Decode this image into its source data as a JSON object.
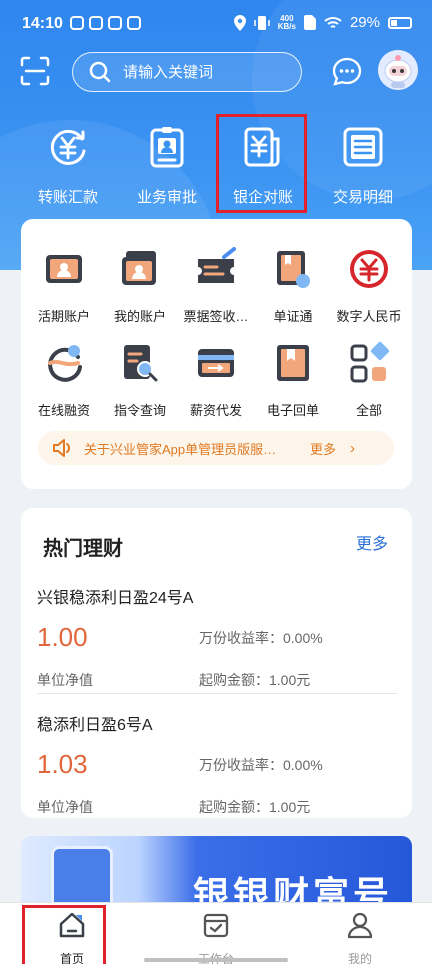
{
  "status_bar": {
    "time": "14:10",
    "speed_top": "400",
    "speed_bottom": "KB/s",
    "battery": "29%"
  },
  "header": {
    "search_placeholder": "请输入关键词"
  },
  "top_nav": [
    {
      "label": "转账汇款",
      "icon": "yuan-transfer-icon"
    },
    {
      "label": "业务审批",
      "icon": "approval-badge-icon"
    },
    {
      "label": "银企对账",
      "icon": "yuan-document-icon"
    },
    {
      "label": "交易明细",
      "icon": "list-detail-icon"
    }
  ],
  "menu": [
    {
      "label": "活期账户",
      "icon": "account-card-icon"
    },
    {
      "label": "我的账户",
      "icon": "my-account-icon"
    },
    {
      "label": "票据签收…",
      "icon": "bill-ticket-icon"
    },
    {
      "label": "单证通",
      "icon": "document-pass-icon"
    },
    {
      "label": "数字人民币",
      "icon": "digital-rmb-icon"
    },
    {
      "label": "在线融资",
      "icon": "online-finance-icon"
    },
    {
      "label": "指令查询",
      "icon": "instruction-search-icon"
    },
    {
      "label": "薪资代发",
      "icon": "payroll-card-icon"
    },
    {
      "label": "电子回单",
      "icon": "e-receipt-icon"
    },
    {
      "label": "全部",
      "icon": "all-apps-icon"
    }
  ],
  "notice": {
    "text": "关于兴业管家App单管理员版服…",
    "more": "更多"
  },
  "finance": {
    "title": "热门理财",
    "more": "更多",
    "products": [
      {
        "name": "兴银稳添利日盈24号A",
        "value": "1.00",
        "unit_label": "单位净值",
        "rate": "万份收益率：0.00%",
        "min": "起购金额：1.00元"
      },
      {
        "name": "稳添利日盈6号A",
        "value": "1.03",
        "unit_label": "单位净值",
        "rate": "万份收益率：0.00%",
        "min": "起购金额：1.00元"
      }
    ]
  },
  "banner": {
    "text": "银银财富号"
  },
  "tabbar": [
    {
      "label": "首页",
      "icon": "home-icon",
      "active": true
    },
    {
      "label": "工作台",
      "icon": "workbench-icon",
      "active": false
    },
    {
      "label": "我的",
      "icon": "profile-icon",
      "active": false
    }
  ],
  "colors": {
    "primary": "#2f86ee",
    "accent_orange": "#e2663b",
    "highlight_red": "#e0232a",
    "link_blue": "#2a6fd6"
  }
}
